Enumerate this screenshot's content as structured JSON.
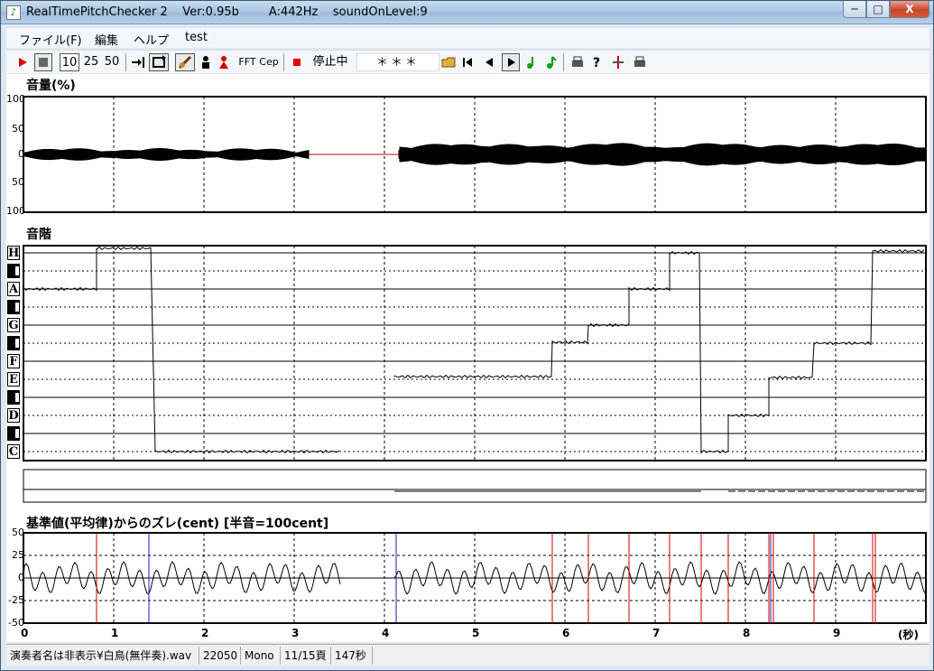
{
  "window": {
    "title": "RealTimePitchChecker 2    Ver:0.95b        A:442Hz    soundOnLevel:9",
    "minimize": "─",
    "maximize": "□",
    "close": "X"
  },
  "menu": [
    "ファイル(F)",
    "編集",
    "ヘルプ",
    "test"
  ],
  "toolbar": {
    "speed_10": "10",
    "speed_25": "25",
    "speed_50": "50",
    "fft": "FFT",
    "cep": "Cep",
    "state": "停止中",
    "display": "＊＊＊"
  },
  "volume_panel": {
    "label": "音量(%)",
    "ticks": [
      "100",
      "50",
      "0",
      "50",
      "100"
    ]
  },
  "scale_panel": {
    "label": "音階",
    "notes": [
      "H",
      "A",
      "G",
      "F",
      "E",
      "D",
      "C"
    ]
  },
  "deviation_panel": {
    "label": "基準値(平均律)からのズレ(cent) [半音=100cent]",
    "ticks": [
      "50",
      "25",
      "0",
      "-25",
      "-50"
    ]
  },
  "time_axis": {
    "ticks": [
      "0",
      "1",
      "2",
      "3",
      "4",
      "5",
      "6",
      "7",
      "8",
      "9"
    ],
    "unit": "(秒)"
  },
  "statusbar": {
    "file": "演奏者名は非表示¥白鳥(無伴奏).wav",
    "rate": "22050",
    "channels": "Mono",
    "page": "11/15頁",
    "duration": "147秒"
  }
}
